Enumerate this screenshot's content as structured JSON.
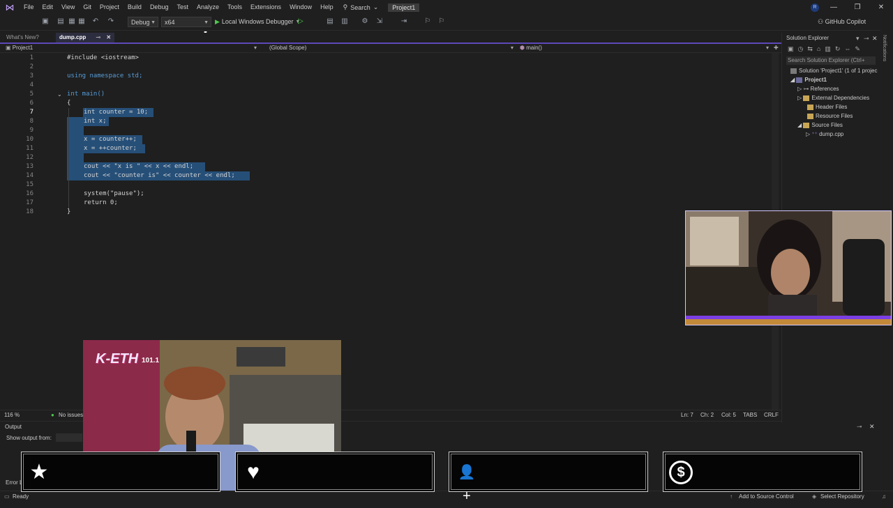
{
  "menubar": {
    "items": [
      "File",
      "Edit",
      "View",
      "Git",
      "Project",
      "Build",
      "Debug",
      "Test",
      "Analyze",
      "Tools",
      "Extensions",
      "Window",
      "Help"
    ],
    "search_label": "Search",
    "project_badge": "Project1",
    "avatar_initial": "R",
    "copilot_label": "GitHub Copilot"
  },
  "toolbar": {
    "config": "Debug",
    "platform": "x64",
    "run_label": "Local Windows Debugger"
  },
  "tabs": {
    "whats_new": "What's New?",
    "active": "dump.cpp"
  },
  "navbar": {
    "project": "Project1",
    "scope": "(Global Scope)",
    "member": "main()"
  },
  "editor": {
    "lines": [
      {
        "n": "1",
        "text": "#include <iostream>"
      },
      {
        "n": "2",
        "text": ""
      },
      {
        "n": "3",
        "text": "using namespace std;"
      },
      {
        "n": "4",
        "text": ""
      },
      {
        "n": "5",
        "text": "int main()"
      },
      {
        "n": "6",
        "text": "{"
      },
      {
        "n": "7",
        "text": "int counter = 10;"
      },
      {
        "n": "8",
        "text": "int x;"
      },
      {
        "n": "9",
        "text": ""
      },
      {
        "n": "10",
        "text": "x = counter++;"
      },
      {
        "n": "11",
        "text": "x = ++counter;"
      },
      {
        "n": "12",
        "text": ""
      },
      {
        "n": "13",
        "text": "cout << \"x is \" << x << endl;"
      },
      {
        "n": "14",
        "text": "cout << \"counter is\" << counter << endl;"
      },
      {
        "n": "15",
        "text": ""
      },
      {
        "n": "16",
        "text": "system(\"pause\");"
      },
      {
        "n": "17",
        "text": "return 0;"
      },
      {
        "n": "18",
        "text": "}"
      }
    ]
  },
  "infobar": {
    "zoom": "116 %",
    "issues": "No issues",
    "line": "Ln: 7",
    "ch": "Ch: 2",
    "col": "Col: 5",
    "tabs": "TABS",
    "eol": "CRLF"
  },
  "output": {
    "title": "Output",
    "show_from": "Show output from:",
    "error_list": "Error Li"
  },
  "solution_explorer": {
    "title": "Solution Explorer",
    "search_placeholder": "Search Solution Explorer (Ctrl+",
    "solution": "Solution 'Project1' (1 of 1 projec",
    "project": "Project1",
    "items": [
      "References",
      "External Dependencies",
      "Header Files",
      "Resource Files",
      "Source Files",
      "dump.cpp"
    ]
  },
  "notifications_label": "Notifications",
  "statusbar": {
    "ready": "Ready",
    "add_source": "Add to Source Control",
    "select_repo": "Select Repository"
  },
  "overlay": {
    "station_name": "K-ETH",
    "station_number": "101.1"
  },
  "alerts": [
    {
      "icon": "star-icon",
      "glyph": "★"
    },
    {
      "icon": "heart-icon",
      "glyph": "♥"
    },
    {
      "icon": "add-user-icon",
      "glyph": "👤+"
    },
    {
      "icon": "dollar-icon",
      "glyph": "$"
    }
  ],
  "colors": {
    "accent": "#5e48b8",
    "selection": "#264f78",
    "keyword": "#569cd6",
    "string": "#ce9178"
  }
}
